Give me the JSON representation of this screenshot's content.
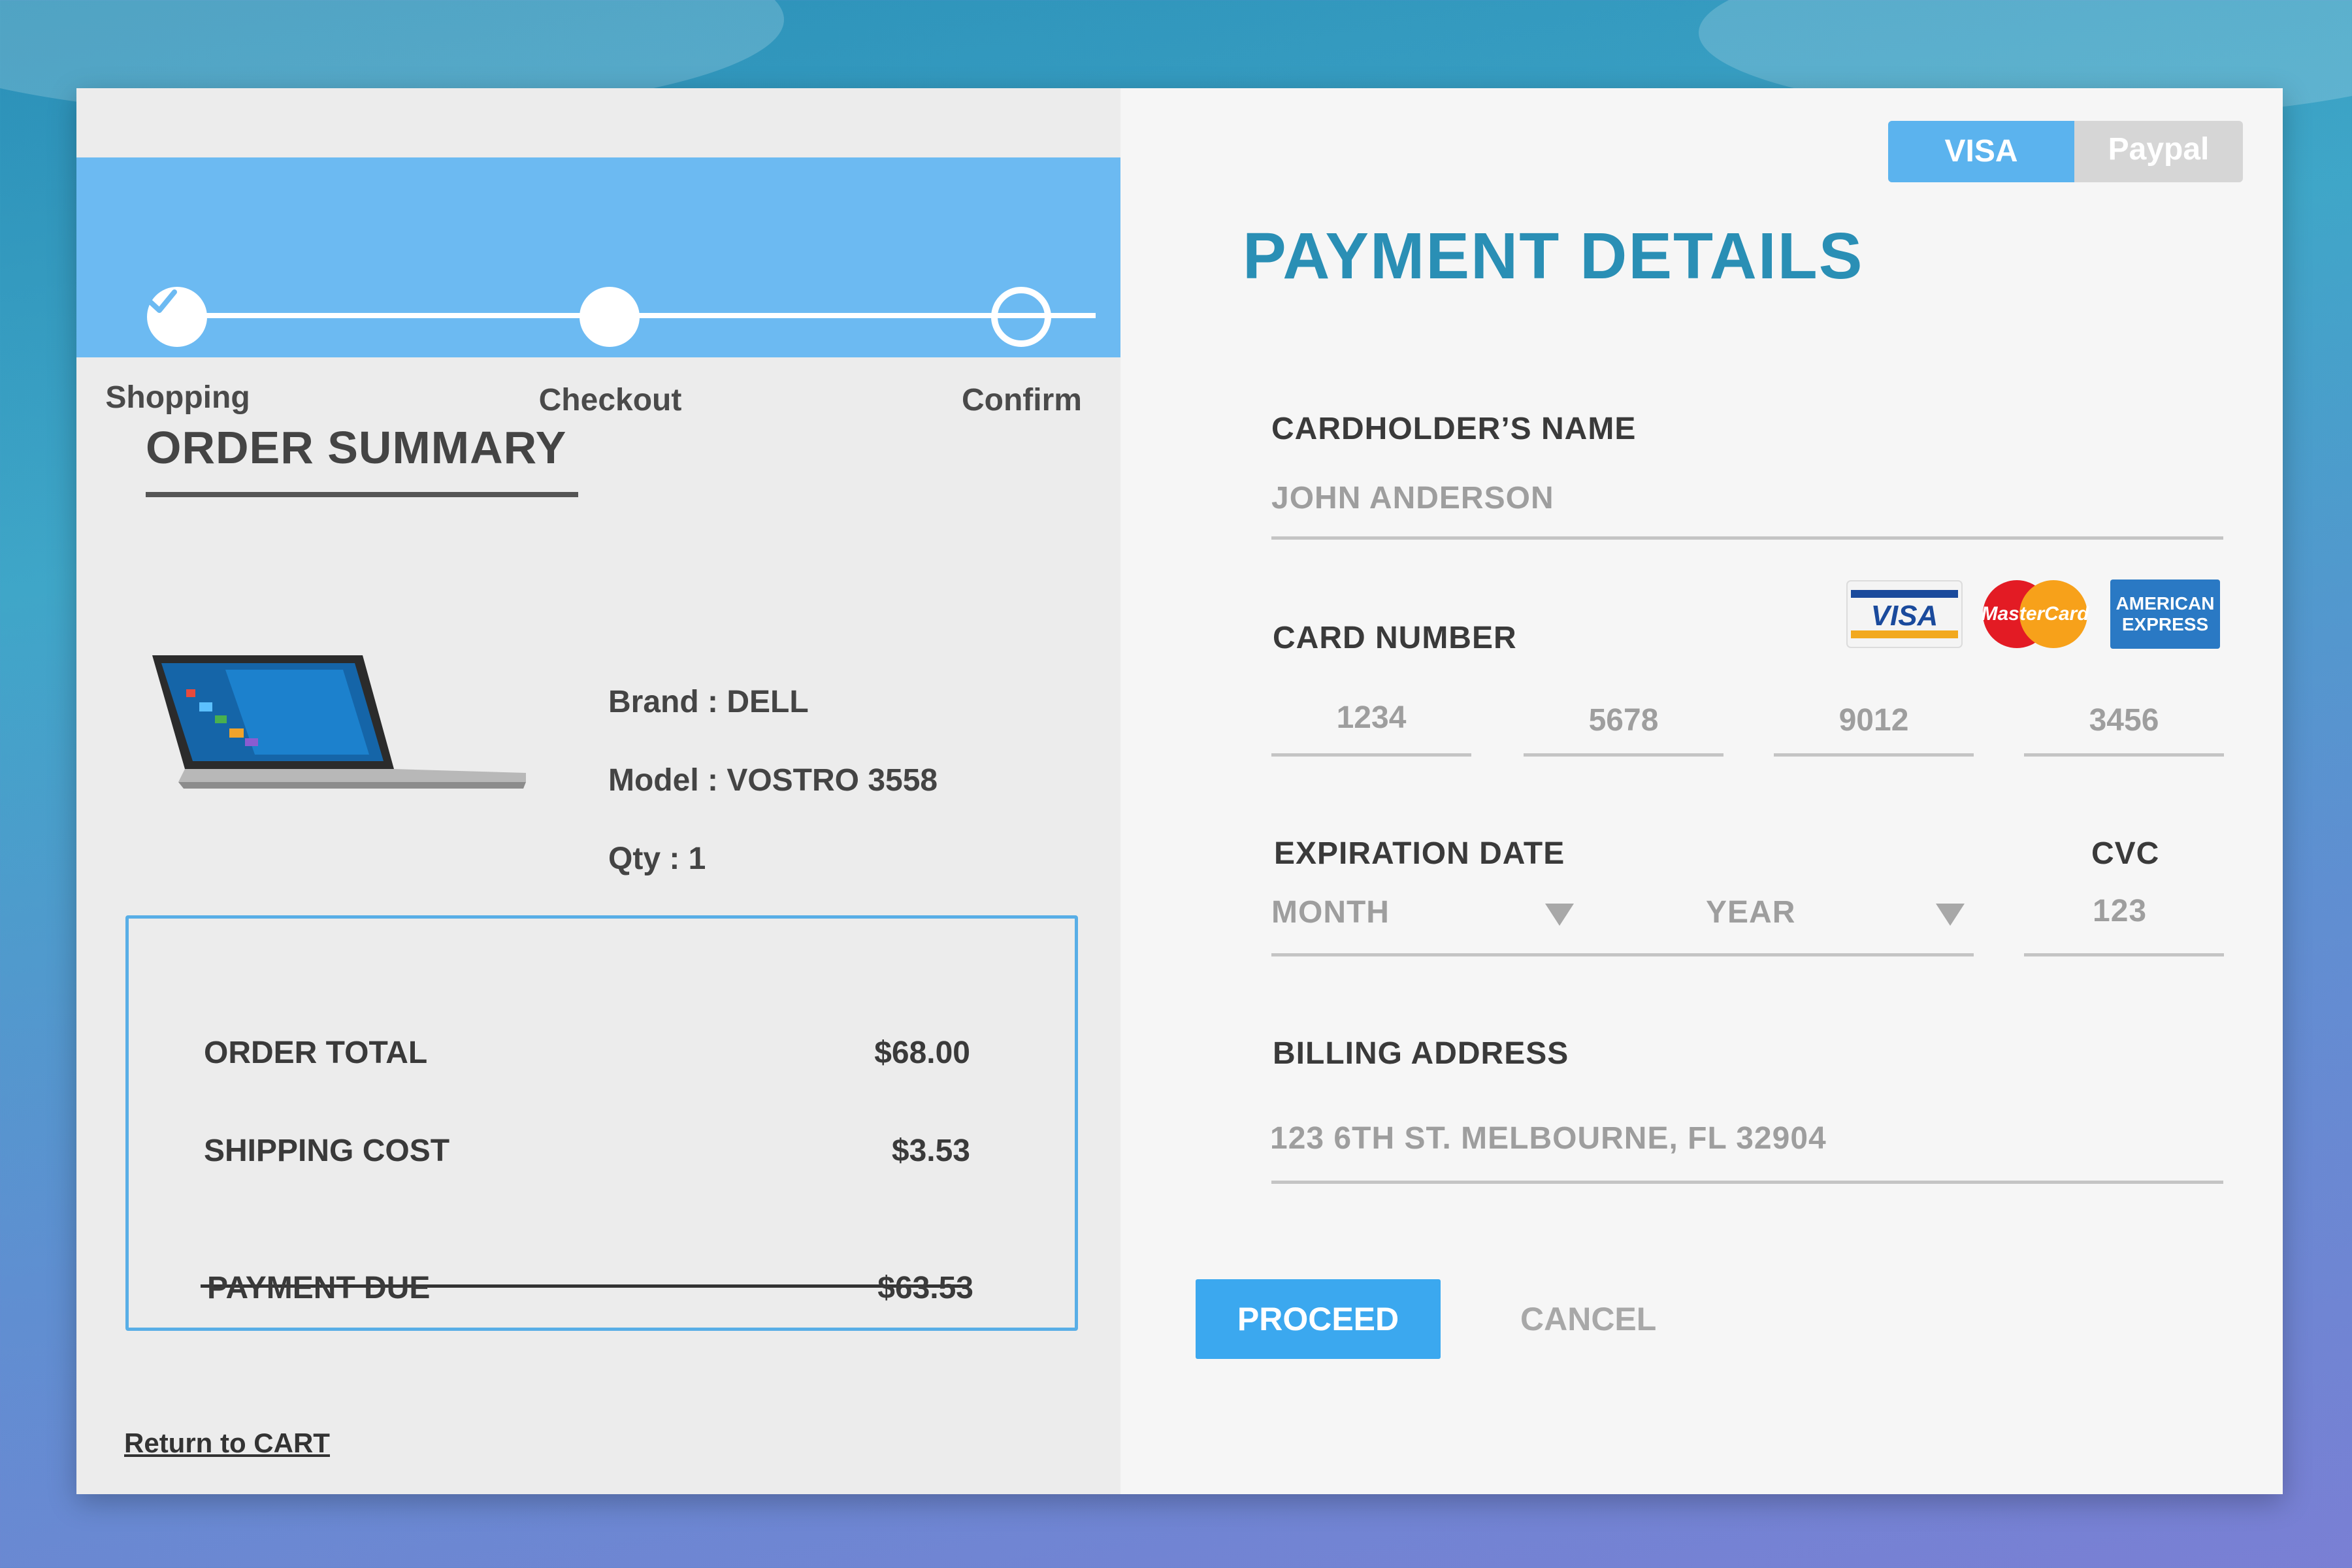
{
  "progress": {
    "steps": [
      {
        "label": "Shopping",
        "state": "done"
      },
      {
        "label": "Checkout",
        "state": "current"
      },
      {
        "label": "Confirm",
        "state": "pending"
      }
    ]
  },
  "order_summary": {
    "title": "ORDER SUMMARY",
    "product": {
      "brand": "Brand : DELL",
      "model": "Model : VOSTRO 3558",
      "qty": "Qty : 1"
    },
    "totals": {
      "order_total_label": "ORDER TOTAL",
      "order_total_value": "$68.00",
      "shipping_label": "SHIPPING COST",
      "shipping_value": "$3.53",
      "due_label": "PAYMENT DUE",
      "due_value": "$63.53"
    },
    "return_link": "Return to CART"
  },
  "payment": {
    "methods": {
      "visa": "VISA",
      "paypal": "Paypal",
      "selected": "VISA"
    },
    "title": "PAYMENT DETAILS",
    "cardholder_label": "CARDHOLDER’S NAME",
    "cardholder_placeholder": "JOHN ANDERSON",
    "card_number_label": "CARD NUMBER",
    "card_number_segments": [
      "1234",
      "5678",
      "9012",
      "3456"
    ],
    "card_logos": {
      "visa": "VISA",
      "mastercard": "MasterCard",
      "amex_line1": "AMERICAN",
      "amex_line2": "EXPRESS"
    },
    "expiration_label": "EXPIRATION DATE",
    "month_placeholder": "MONTH",
    "year_placeholder": "YEAR",
    "cvc_label": "CVC",
    "cvc_placeholder": "123",
    "billing_label": "BILLING ADDRESS",
    "billing_placeholder": "123 6TH ST. MELBOURNE, FL 32904",
    "proceed_label": "PROCEED",
    "cancel_label": "CANCEL"
  },
  "colors": {
    "accent": "#3ba8ef",
    "ribbon": "#6cbaf2",
    "title": "#2a8fb5",
    "box_border": "#58aee6"
  }
}
